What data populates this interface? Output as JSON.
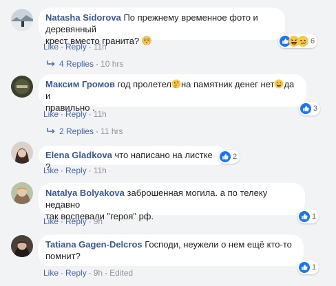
{
  "comments": [
    {
      "author": "Natasha Sidorova",
      "text_lines": [
        "По прежнему временное фото и деревянный",
        "крест вместо гранита? "
      ],
      "actions": {
        "like": "Like",
        "reply": "Reply",
        "time": "11h"
      },
      "reactions": {
        "count": "6",
        "icons": [
          "like-icon",
          "haha-icon",
          "sad-icon"
        ]
      },
      "replies": {
        "label": "4 Replies",
        "time": "10 hrs"
      }
    },
    {
      "author": "Максим Громов",
      "text_a": " год пролетел",
      "text_b": "на памятник денег нет",
      "text_c": "да и",
      "text_line2": "правильно .",
      "actions": {
        "like": "Like",
        "reply": "Reply",
        "time": "11h"
      },
      "reactions": {
        "count": "3",
        "icons": [
          "like-icon"
        ]
      },
      "replies": {
        "label": "2 Replies",
        "time": "11 hrs"
      }
    },
    {
      "author": "Elena Gladkova",
      "text": " что написано на листке ?",
      "actions": {
        "like": "Like",
        "reply": "Reply",
        "time": "11h"
      },
      "reactions": {
        "count": "2",
        "icons": [
          "like-icon"
        ]
      }
    },
    {
      "author": "Natalya Bolyakova",
      "text_first": " заброшенная могила. а по телеку недавно",
      "text_line2": "так воспевали \"героя\" рф.",
      "actions": {
        "like": "Like",
        "reply": "Reply",
        "time": "9h"
      },
      "reactions": {
        "count": "1",
        "icons": [
          "like-icon"
        ]
      }
    },
    {
      "author": "Tatiana Gagen-Delcros",
      "text_first": " Господи, неужели о нем ещё кто-то",
      "text_line2": "помнит?",
      "actions": {
        "like": "Like",
        "reply": "Reply",
        "time": "9h",
        "edited": "Edited"
      },
      "reactions": {
        "count": "1",
        "icons": [
          "like-icon"
        ]
      }
    }
  ],
  "separator": "·",
  "colors": {
    "background": "#f2f3f5",
    "bubble": "#ffffff",
    "author": "#385898",
    "link": "#4267b2",
    "meta": "#90949c",
    "like_blue": "#1877f2"
  }
}
